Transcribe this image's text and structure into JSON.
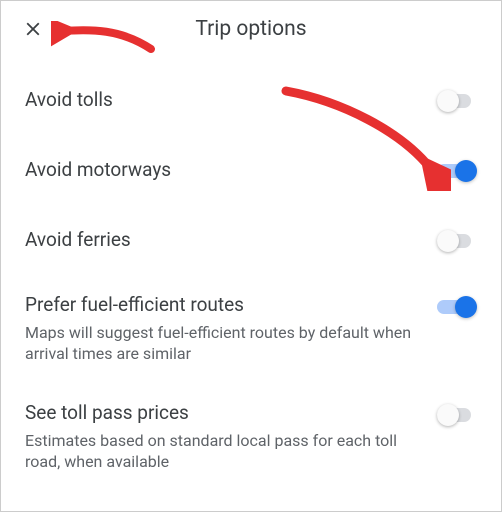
{
  "header": {
    "title": "Trip options",
    "close_icon": "close-icon"
  },
  "options": [
    {
      "label": "Avoid tolls",
      "description": null,
      "on": false
    },
    {
      "label": "Avoid motorways",
      "description": null,
      "on": true
    },
    {
      "label": "Avoid ferries",
      "description": null,
      "on": false
    },
    {
      "label": "Prefer fuel-efficient routes",
      "description": "Maps will suggest fuel-efficient routes by default when arrival times are similar",
      "on": true
    },
    {
      "label": "See toll pass prices",
      "description": "Estimates based on standard local pass for each toll road, when available",
      "on": false
    }
  ],
  "colors": {
    "accent": "#1a73e8",
    "accent_track": "#aecbfa",
    "arrow": "#e63030"
  }
}
